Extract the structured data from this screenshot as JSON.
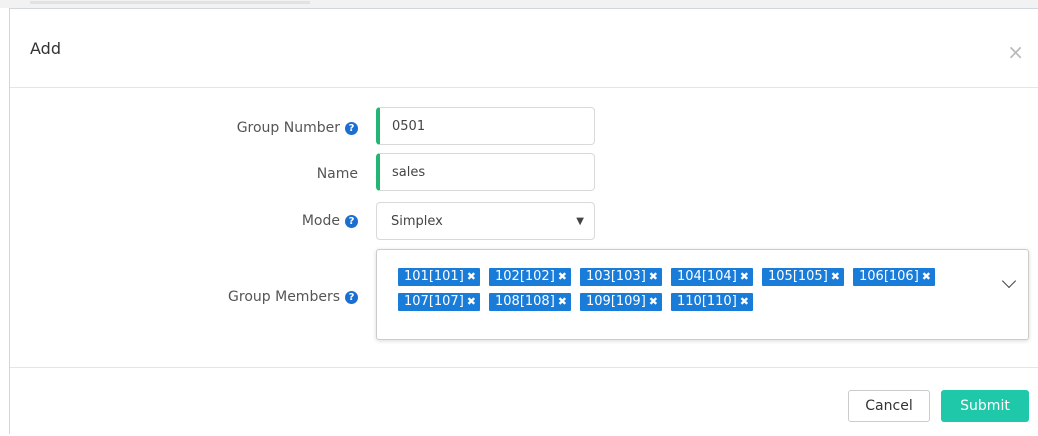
{
  "dialog": {
    "title": "Add",
    "close_glyph": "×"
  },
  "form": {
    "group_number": {
      "label": "Group Number",
      "value": "0501",
      "help_icon": "question-circle-icon"
    },
    "name": {
      "label": "Name",
      "value": "sales"
    },
    "mode": {
      "label": "Mode",
      "value": "Simplex",
      "help_icon": "question-circle-icon"
    },
    "group_members": {
      "label": "Group Members",
      "help_icon": "question-circle-icon",
      "tags": [
        "101[101]",
        "102[102]",
        "103[103]",
        "104[104]",
        "105[105]",
        "106[106]",
        "107[107]",
        "108[108]",
        "109[109]",
        "110[110]"
      ],
      "remove_glyph": "✖"
    }
  },
  "footer": {
    "cancel_label": "Cancel",
    "submit_label": "Submit"
  },
  "colors": {
    "accent": "#1a7cd9",
    "valid_border": "#22b573",
    "submit": "#1ec8a8"
  }
}
